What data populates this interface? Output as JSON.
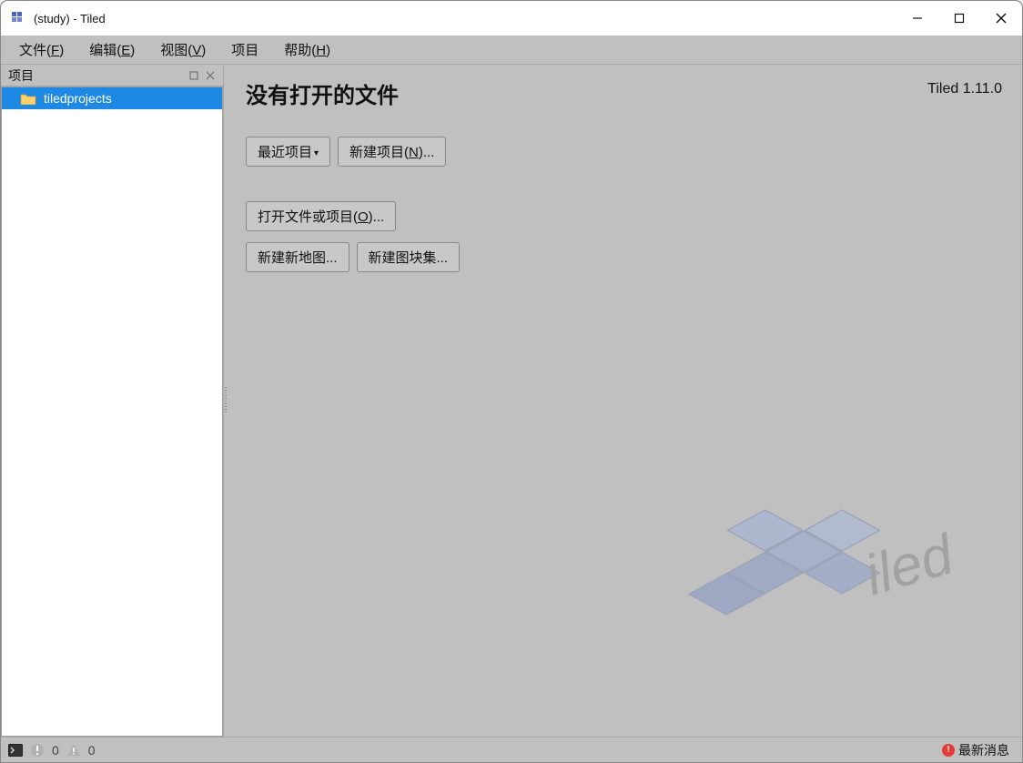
{
  "titlebar": {
    "title": "(study) - Tiled"
  },
  "menubar": {
    "items": [
      {
        "label": "文件",
        "mnemonic": "F"
      },
      {
        "label": "编辑",
        "mnemonic": "E"
      },
      {
        "label": "视图",
        "mnemonic": "V"
      },
      {
        "label": "项目",
        "mnemonic": ""
      },
      {
        "label": "帮助",
        "mnemonic": "H"
      }
    ]
  },
  "sidebar": {
    "panel_title": "项目",
    "items": [
      {
        "name": "tiledprojects"
      }
    ]
  },
  "main": {
    "heading": "没有打开的文件",
    "version": "Tiled 1.11.0",
    "buttons": {
      "recent_projects": "最近项目",
      "new_project": "新建项目(N)...",
      "open_file_or_project": "打开文件或项目(O)...",
      "new_map": "新建新地图...",
      "new_tileset": "新建图块集..."
    }
  },
  "statusbar": {
    "error_count": "0",
    "warning_count": "0",
    "news_label": "最新消息"
  }
}
